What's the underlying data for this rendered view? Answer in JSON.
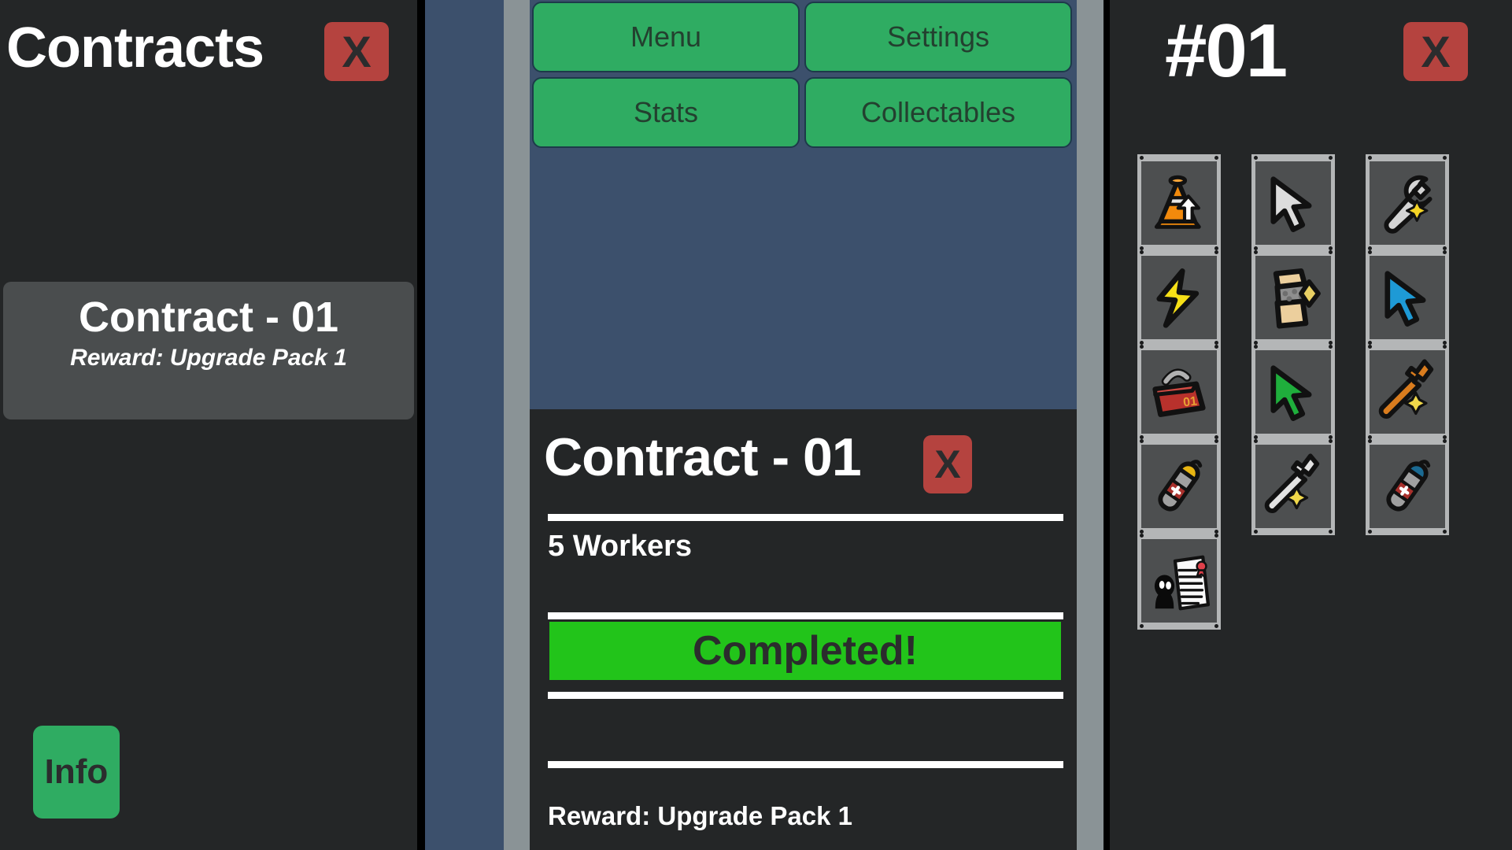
{
  "contracts_panel": {
    "title": "Contracts",
    "close_label": "X",
    "card": {
      "title": "Contract - 01",
      "reward": "Reward: Upgrade Pack 1"
    },
    "info_label": "Info"
  },
  "toolbar": {
    "buttons": [
      {
        "label": "Menu",
        "name": "menu"
      },
      {
        "label": "Settings",
        "name": "settings"
      },
      {
        "label": "Stats",
        "name": "stats"
      },
      {
        "label": "Collectables",
        "name": "collectables"
      }
    ]
  },
  "contract_dialog": {
    "title": "Contract - 01",
    "close_label": "X",
    "workers": "5 Workers",
    "progress_label": "Completed!",
    "reward": "Reward: Upgrade Pack 1"
  },
  "inventory_panel": {
    "title": "#01",
    "close_label": "X",
    "slots": [
      {
        "icon": "traffic-cone-upgrade-icon"
      },
      {
        "icon": "white-cursor-icon"
      },
      {
        "icon": "wrench-sparkle-icon"
      },
      {
        "icon": "lightning-bolt-icon"
      },
      {
        "icon": "gravel-bag-icon"
      },
      {
        "icon": "blue-cursor-icon"
      },
      {
        "icon": "red-toolbox-icon"
      },
      {
        "icon": "green-cursor-icon"
      },
      {
        "icon": "orange-wrench-sparkle-icon"
      },
      {
        "icon": "yellow-fire-extinguisher-icon"
      },
      {
        "icon": "silver-wrench-sparkle-icon"
      },
      {
        "icon": "blue-fire-extinguisher-icon"
      },
      {
        "icon": "contract-document-icon"
      }
    ]
  },
  "colors": {
    "panel_bg": "#242627",
    "game_bg": "#3c506c",
    "gutter": "#8a9396",
    "green_button": "#2fac62",
    "red_close": "#b5433f",
    "progress_green": "#22c41a",
    "card_bg": "#4a4d4e",
    "slot_bg": "#4d4f50",
    "slot_frame": "#b4b6b7"
  }
}
